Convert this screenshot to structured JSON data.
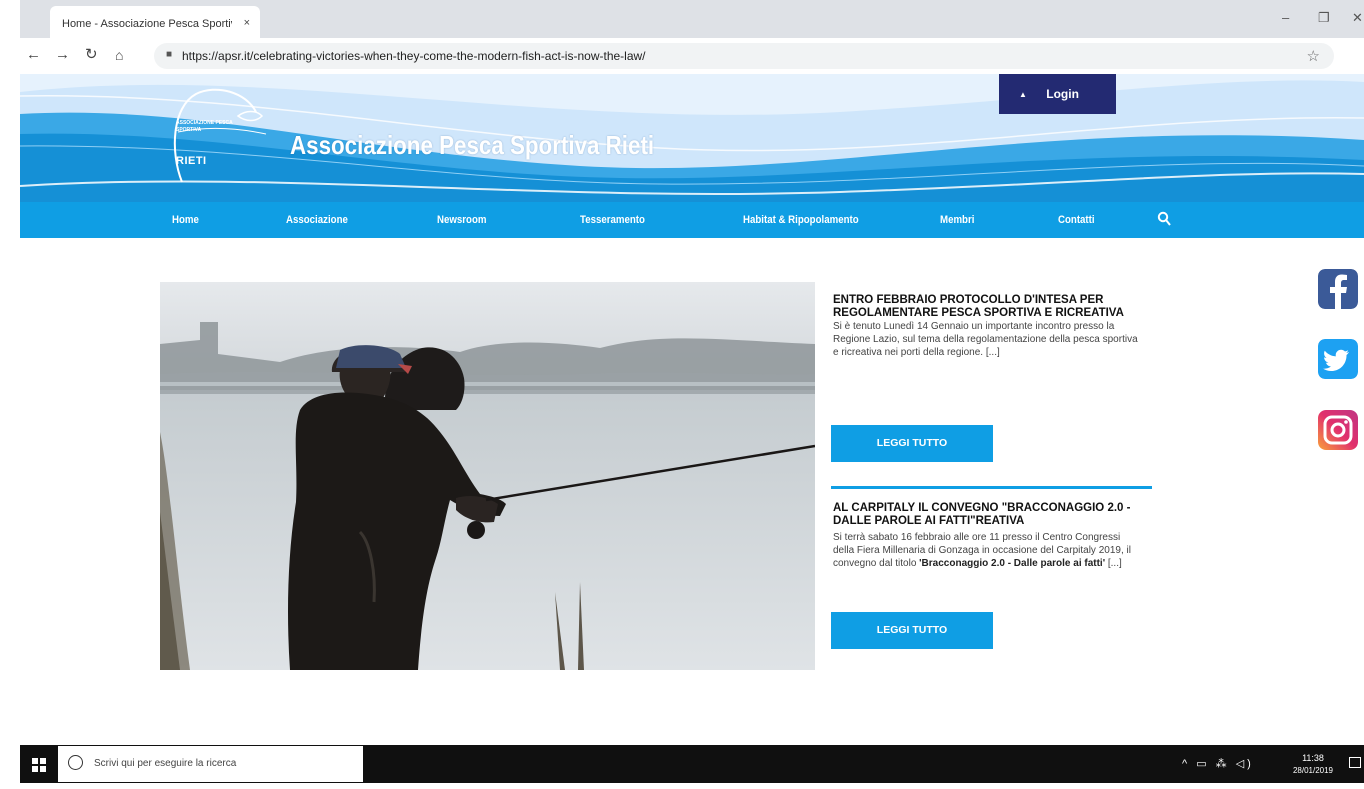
{
  "browser": {
    "tab_title": "Home - Associazione Pesca Sportiva Rieti",
    "tab_close": "×",
    "url": "https://apsr.it/celebrating-victories-when-they-come-the-modern-fish-act-is-now-the-law/",
    "icons": {
      "back": "arrow-left",
      "forward": "arrow-right",
      "reload": "reload",
      "home": "home",
      "lock": "lock",
      "star": "star"
    }
  },
  "site": {
    "title": "Associazione Pesca Sportiva Rieti",
    "logo_small": "ASSOCIAZIONE PESCA SPORTIVA",
    "logo_name": "RIETI",
    "login_label": "Login",
    "colors": {
      "nav": "#0f9ee4",
      "login": "#232a72",
      "header_bg": "#cfe6fb"
    }
  },
  "nav": {
    "items": [
      "Home",
      "Associazione",
      "Newsroom",
      "Tesseramento",
      "Habitat & Ripopolamento",
      "Membri",
      "Contatti"
    ]
  },
  "articles": [
    {
      "title": "ENTRO FEBBRAIO PROTOCOLLO D'INTESA PER REGOLAMENTARE PESCA SPORTIVA E RICREATIVA",
      "excerpt": "Si è tenuto Lunedì 14 Gennaio un importante incontro presso la Regione Lazio, sul tema della regolamentazione della pesca sportiva e ricreativa nei porti della regione. [...]",
      "read_more": "LEGGI TUTTO"
    },
    {
      "title": "AL CARPITALY IL CONVEGNO \"BRACCONAGGIO 2.0 - DALLE PAROLE AI FATTI\"REATIVA",
      "excerpt_start": "Si terrà sabato 16 febbraio alle ore 11 presso il Centro Congressi della Fiera Millenaria di Gonzaga in occasione del Carpitaly 2019, il convegno dal titolo ",
      "excerpt_bold": "'Bracconaggio 2.0 - Dalle parole ai fatti'",
      "excerpt_end": " [...]",
      "read_more": "LEGGI TUTTO"
    }
  ],
  "social": {
    "icons": [
      "facebook-icon",
      "twitter-icon",
      "instagram-icon"
    ]
  },
  "taskbar": {
    "search_placeholder": "Scrivi qui per eseguire la ricerca",
    "tray": "^ ▭ ⁂ ◁)",
    "time": "11:38",
    "date": "28/01/2019"
  }
}
